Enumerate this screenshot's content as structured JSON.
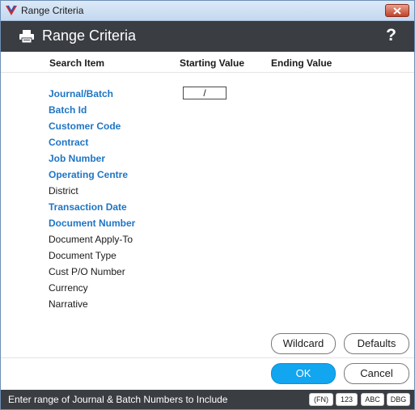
{
  "window": {
    "title": "Range Criteria"
  },
  "header": {
    "title": "Range Criteria",
    "help_label": "?"
  },
  "columns": {
    "search_item": "Search Item",
    "starting_value": "Starting Value",
    "ending_value": "Ending Value"
  },
  "items": [
    {
      "label": "Journal/Batch",
      "active": true
    },
    {
      "label": "Batch Id",
      "active": true
    },
    {
      "label": "Customer Code",
      "active": true
    },
    {
      "label": "Contract",
      "active": true
    },
    {
      "label": "Job Number",
      "active": true
    },
    {
      "label": "Operating Centre",
      "active": true
    },
    {
      "label": "District",
      "active": false
    },
    {
      "label": "Transaction Date",
      "active": true
    },
    {
      "label": "Document Number",
      "active": true
    },
    {
      "label": "Document Apply-To",
      "active": false
    },
    {
      "label": "Document Type",
      "active": false
    },
    {
      "label": "Cust P/O Number",
      "active": false
    },
    {
      "label": "Currency",
      "active": false
    },
    {
      "label": "Narrative",
      "active": false
    }
  ],
  "journal_batch_start": {
    "value": "/"
  },
  "buttons": {
    "wildcard": "Wildcard",
    "defaults": "Defaults",
    "ok": "OK",
    "cancel": "Cancel"
  },
  "status": {
    "text": "Enter range of Journal & Batch Numbers to Include",
    "badges": [
      "(FN)",
      "123",
      "ABC",
      "DBG"
    ]
  },
  "colors": {
    "active_item": "#1f75c4",
    "header_bg": "#3a3d42",
    "primary_button": "#12a5f0"
  }
}
